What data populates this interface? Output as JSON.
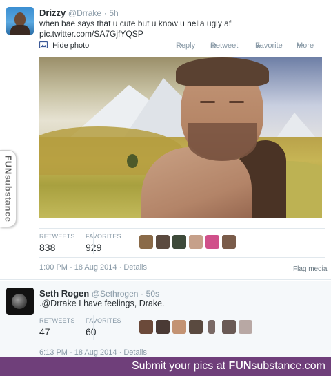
{
  "tweet1": {
    "name": "Drizzy",
    "handle": "@Drrake",
    "dot": "·",
    "time": "5h",
    "text": "when bae says that u cute but u know u hella ugly af",
    "link": "pic.twitter.com/SA7GjfYQSP",
    "actions": {
      "hide_photo": "Hide photo",
      "reply": "Reply",
      "retweet": "Retweet",
      "favorite": "Favorite",
      "more": "More"
    },
    "stats": {
      "retweets_label": "RETWEETS",
      "retweets_value": "838",
      "favorites_label": "FAVORITES",
      "favorites_value": "929"
    },
    "timestamp": "1:00 PM - 18 Aug 2014",
    "details": "Details",
    "flag_media": "Flag media"
  },
  "tweet2": {
    "name": "Seth Rogen",
    "handle": "@Sethrogen",
    "dot": "·",
    "time": "50s",
    "text": ".@Drrake I have feelings, Drake.",
    "stats": {
      "retweets_label": "RETWEETS",
      "retweets_value": "47",
      "favorites_label": "FAVORITES",
      "favorites_value": "60"
    },
    "timestamp": "6:13 PM - 18 Aug 2014",
    "details": "Details"
  },
  "side_tab": {
    "part1": "FUN",
    "part2": "substance"
  },
  "footer": {
    "text": "Submit your pics at",
    "brand_bold": "FUN",
    "brand_rest": "substance.com"
  },
  "icons": {
    "hide_photo": "image-icon",
    "reply": "reply-icon",
    "retweet": "retweet-icon",
    "favorite": "star-icon",
    "more": "more-dots-icon"
  },
  "colors": {
    "footer_bg": "#6f3f7a",
    "text_muted": "#8899a6",
    "text_main": "#292f33"
  }
}
